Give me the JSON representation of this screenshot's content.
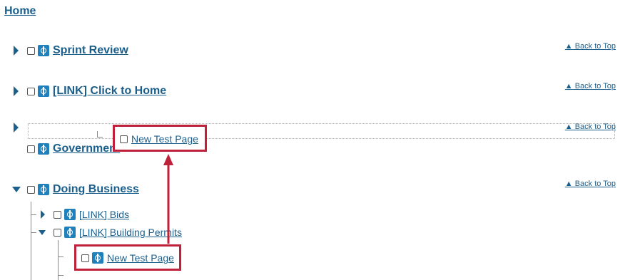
{
  "home_label": "Home",
  "back_to_top": "▲ Back to Top",
  "items": {
    "sprint": "Sprint Review",
    "link_home": "[LINK] Click to Home",
    "government": "Government",
    "doing_business": "Doing Business",
    "bids": "[LINK] Bids",
    "permits": "[LINK] Building Permits",
    "new_page": "New Test Page"
  },
  "colors": {
    "link": "#1b5f8c",
    "icon": "#1f80bc",
    "highlight": "#c0213a"
  }
}
